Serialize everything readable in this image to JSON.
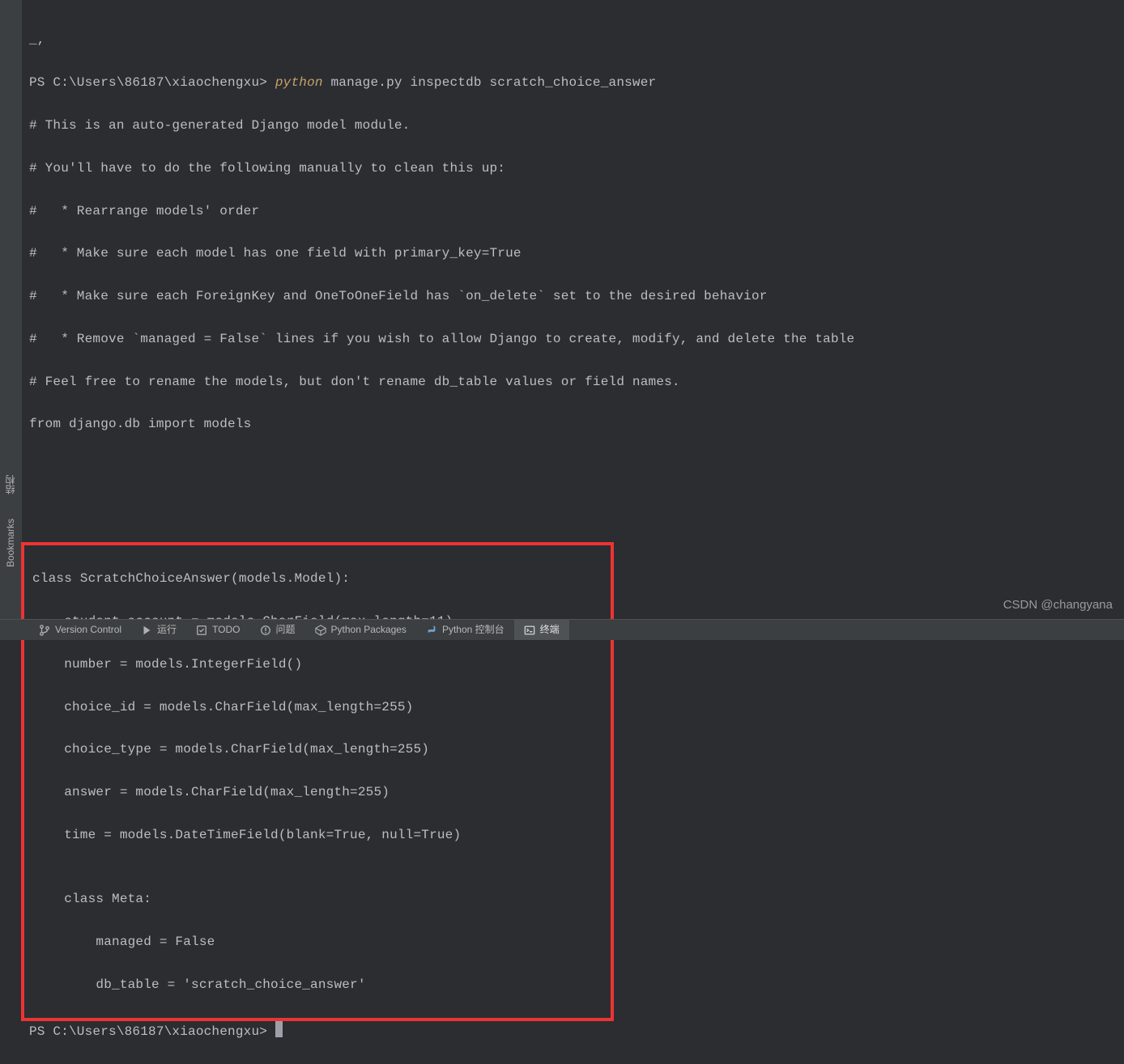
{
  "prompt": {
    "ps": "PS ",
    "path": "C:\\Users\\86187\\xiaochengxu> ",
    "python_kw": "python",
    "rest_cmd": " manage.py inspectdb scratch_choice_answer"
  },
  "out": {
    "l0": "_,",
    "l1": "# This is an auto-generated Django model module.",
    "l2": "# You'll have to do the following manually to clean this up:",
    "l3": "#   * Rearrange models' order",
    "l4": "#   * Make sure each model has one field with primary_key=True",
    "l5": "#   * Make sure each ForeignKey and OneToOneField has `on_delete` set to the desired behavior",
    "l6": "#   * Remove `managed = False` lines if you wish to allow Django to create, modify, and delete the table",
    "l7": "# Feel free to rename the models, but don't rename db_table values or field names.",
    "l8": "from django.db import models"
  },
  "class_block": {
    "c0": "class ScratchChoiceAnswer(models.Model):",
    "c1": "    student_account = models.CharField(max_length=11)",
    "c2": "    number = models.IntegerField()",
    "c3": "    choice_id = models.CharField(max_length=255)",
    "c4": "    choice_type = models.CharField(max_length=255)",
    "c5": "    answer = models.CharField(max_length=255)",
    "c6": "    time = models.DateTimeField(blank=True, null=True)",
    "c7": "",
    "c8": "    class Meta:",
    "c9": "        managed = False",
    "c10": "        db_table = 'scratch_choice_answer'"
  },
  "prompt2": {
    "ps": "PS ",
    "path": "C:\\Users\\86187\\xiaochengxu> "
  },
  "sidebar": {
    "structure": "结构",
    "bookmarks": "Bookmarks"
  },
  "bottombar": {
    "version_control": "Version Control",
    "run": "运行",
    "todo": "TODO",
    "problems": "问题",
    "python_packages": "Python Packages",
    "python_console": "Python 控制台",
    "terminal": "终端"
  },
  "watermark": "CSDN @changyana"
}
